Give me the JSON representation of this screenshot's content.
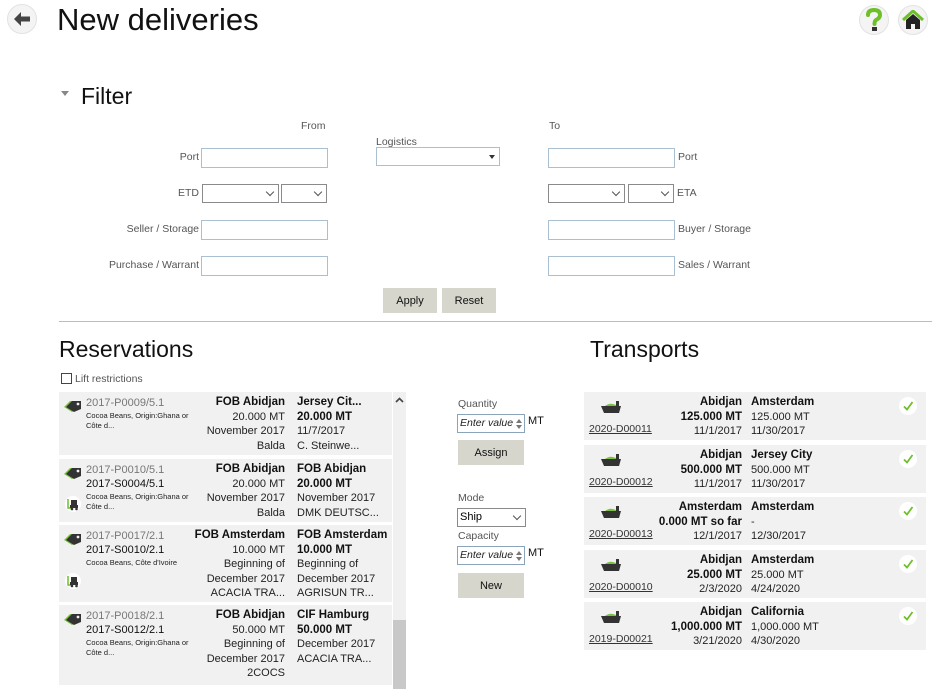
{
  "header": {
    "title": "New deliveries",
    "back_icon": "back-arrow-icon",
    "help_icon": "help-icon",
    "home_icon": "home-icon",
    "accent_color": "#6fbf2a"
  },
  "filter": {
    "title": "Filter",
    "from_heading": "From",
    "to_heading": "To",
    "logistics_label": "Logistics",
    "logistics_value": "",
    "from": {
      "port_label": "Port",
      "port_value": "",
      "etd_label": "ETD",
      "etd_value_1": "",
      "etd_value_2": "",
      "seller_label": "Seller / Storage",
      "seller_value": "",
      "purchase_label": "Purchase / Warrant",
      "purchase_value": ""
    },
    "to": {
      "port_label": "Port",
      "port_value": "",
      "eta_label": "ETA",
      "eta_value_1": "",
      "eta_value_2": "",
      "buyer_label": "Buyer / Storage",
      "buyer_value": "",
      "sales_label": "Sales / Warrant",
      "sales_value": ""
    },
    "apply_label": "Apply",
    "reset_label": "Reset"
  },
  "reservations": {
    "title": "Reservations",
    "lift_restrictions_label": "Lift restrictions",
    "lift_restrictions_checked": false,
    "items": [
      {
        "purchase_id": "2017-P0009/5.1",
        "sales_id": "",
        "description": "Cocoa Beans, Origin:Ghana or Côte d...",
        "from": [
          "FOB Abidjan",
          "20.000 MT",
          "November 2017",
          "Balda"
        ],
        "to": [
          "Jersey Cit...",
          "20.000 MT",
          "11/7/2017",
          "C. Steinwe..."
        ],
        "has_forklift": false
      },
      {
        "purchase_id": "2017-P0010/5.1",
        "sales_id": "2017-S0004/5.1",
        "description": "Cocoa Beans, Origin:Ghana or Côte d...",
        "from": [
          "FOB Abidjan",
          "20.000 MT",
          "November 2017",
          "Balda"
        ],
        "to": [
          "FOB Abidjan",
          "20.000 MT",
          "November 2017",
          "DMK DEUTSC..."
        ],
        "has_forklift": true
      },
      {
        "purchase_id": "2017-P0017/2.1",
        "sales_id": "2017-S0010/2.1",
        "description": "Cocoa Beans, Côte d'Ivoire",
        "from": [
          "FOB Amsterdam",
          "10.000 MT",
          "Beginning of",
          "December 2017",
          "ACACIA TRA..."
        ],
        "to": [
          "FOB Amsterdam",
          "10.000 MT",
          "Beginning of",
          "December 2017",
          "AGRISUN TR..."
        ],
        "has_forklift": true
      },
      {
        "purchase_id": "2017-P0018/2.1",
        "sales_id": "2017-S0012/2.1",
        "description": "Cocoa Beans, Origin:Ghana or Côte d...",
        "from": [
          "FOB Abidjan",
          "50.000 MT",
          "Beginning of",
          "December 2017",
          "2COCS"
        ],
        "to": [
          "CIF Hamburg",
          "50.000 MT",
          "December 2017",
          "ACACIA TRA..."
        ],
        "has_forklift": false
      }
    ]
  },
  "assign_panel": {
    "quantity_label": "Quantity",
    "quantity_placeholder": "Enter value",
    "quantity_unit": "MT",
    "assign_label": "Assign",
    "mode_label": "Mode",
    "mode_value": "Ship",
    "capacity_label": "Capacity",
    "capacity_placeholder": "Enter value",
    "capacity_unit": "MT",
    "new_label": "New"
  },
  "transports": {
    "title": "Transports",
    "items": [
      {
        "id": "2020-D00011",
        "from": [
          "Abidjan",
          "125.000 MT",
          "11/1/2017"
        ],
        "to": [
          "Amsterdam",
          "125.000 MT",
          "11/30/2017"
        ]
      },
      {
        "id": "2020-D00012",
        "from": [
          "Abidjan",
          "500.000 MT",
          "11/1/2017"
        ],
        "to": [
          "Jersey City",
          "500.000 MT",
          "11/30/2017"
        ]
      },
      {
        "id": "2020-D00013",
        "from": [
          "Amsterdam",
          "0.000 MT so far",
          "12/1/2017"
        ],
        "to": [
          "Amsterdam",
          "-",
          "12/30/2017"
        ]
      },
      {
        "id": "2020-D00010",
        "from": [
          "Abidjan",
          "25.000 MT",
          "2/3/2020"
        ],
        "to": [
          "Amsterdam",
          "25.000 MT",
          "4/24/2020"
        ]
      },
      {
        "id": "2019-D00021",
        "from": [
          "Abidjan",
          "1,000.000 MT",
          "3/21/2020"
        ],
        "to": [
          "California",
          "1,000.000 MT",
          "4/30/2020"
        ]
      }
    ]
  }
}
